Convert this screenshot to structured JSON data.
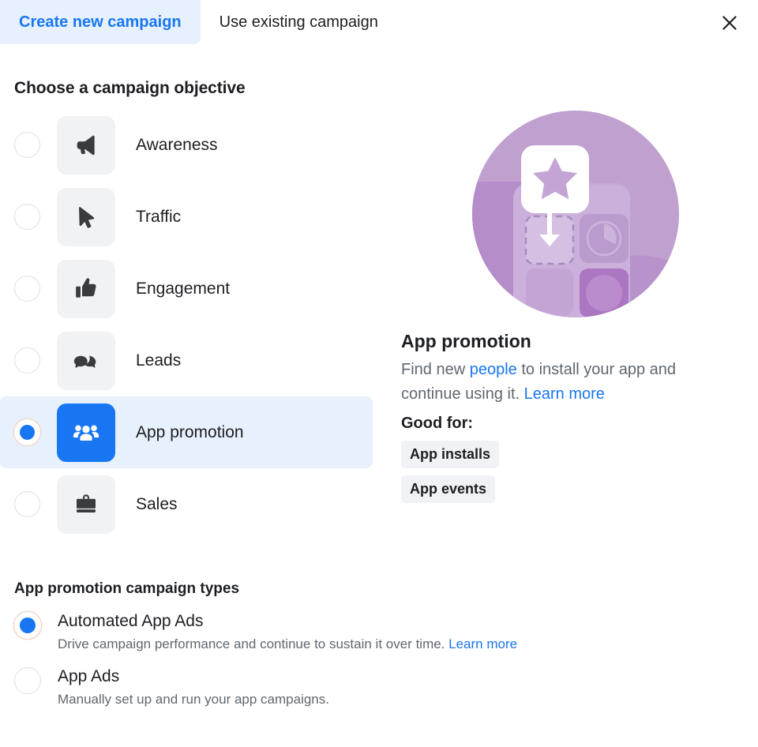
{
  "header": {
    "tabs": [
      {
        "label": "Create new campaign",
        "active": true,
        "name": "tab-create-new-campaign"
      },
      {
        "label": "Use existing campaign",
        "active": false,
        "name": "tab-use-existing-campaign"
      }
    ],
    "close_icon": "close-icon"
  },
  "objective_section": {
    "heading": "Choose a campaign objective",
    "items": [
      {
        "label": "Awareness",
        "icon": "megaphone-icon",
        "selected": false
      },
      {
        "label": "Traffic",
        "icon": "cursor-icon",
        "selected": false
      },
      {
        "label": "Engagement",
        "icon": "thumbs-up-icon",
        "selected": false
      },
      {
        "label": "Leads",
        "icon": "chat-bubbles-icon",
        "selected": false
      },
      {
        "label": "App promotion",
        "icon": "people-icon",
        "selected": true
      },
      {
        "label": "Sales",
        "icon": "shopping-bag-icon",
        "selected": false
      }
    ]
  },
  "detail": {
    "illustration": "app-promotion-illustration",
    "title": "App promotion",
    "desc_part1": "Find new ",
    "desc_link1": "people",
    "desc_part2": " to install your app and continue using it. ",
    "desc_link2": "Learn more",
    "good_for_label": "Good for:",
    "chips": [
      "App installs",
      "App events"
    ]
  },
  "campaign_types": {
    "heading": "App promotion campaign types",
    "options": [
      {
        "title": "Automated App Ads",
        "desc": "Drive campaign performance and continue to sustain it over time. ",
        "link": "Learn more",
        "selected": true
      },
      {
        "title": "App Ads",
        "desc": "Manually set up and run your app campaigns.",
        "link": "",
        "selected": false
      }
    ]
  },
  "colors": {
    "accent_blue": "#1876f2",
    "tab_active_bg": "#e7f0fe",
    "selected_row_bg": "#e7f0fd",
    "tile_bg": "#f1f2f4",
    "chip_bg": "#f0f2f5",
    "muted_text": "#606770",
    "illustration_purple": "#b793c9"
  }
}
